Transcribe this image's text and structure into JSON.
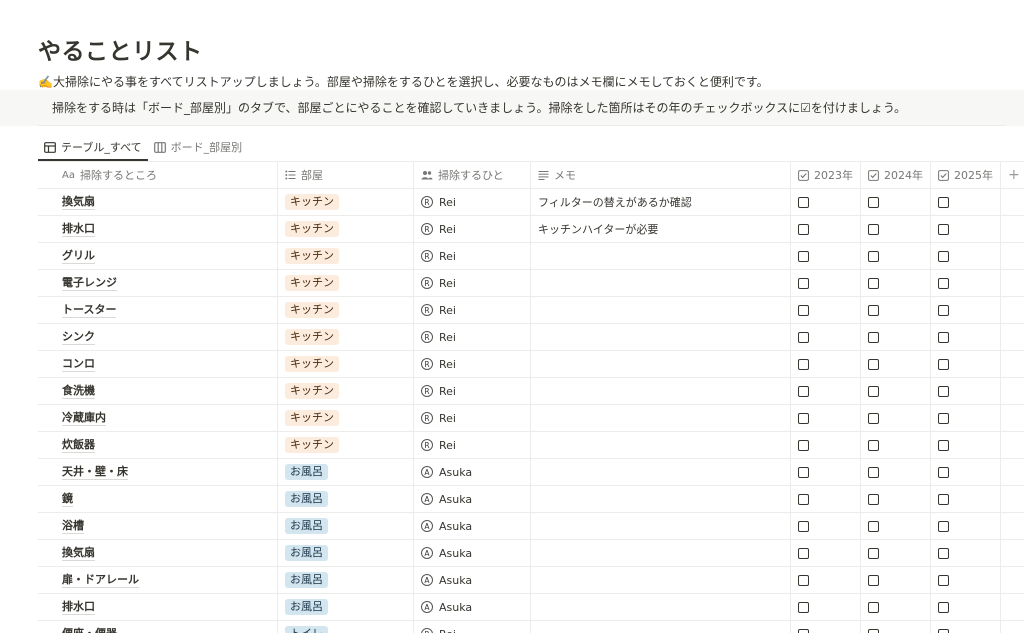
{
  "page": {
    "title": "やることリスト",
    "description_line1": "✍️大掃除にやる事をすべてリストアップしましょう。部屋や掃除をするひとを選択し、必要なものはメモ欄にメモしておくと便利です。",
    "description_line2": "掃除をする時は「ボード_部屋別」のタブで、部屋ごとにやることを確認していきましょう。掃除をした箇所はその年のチェックボックスに☑を付けましょう。"
  },
  "tabs": [
    {
      "label": "テーブル_すべて",
      "icon": "table-icon",
      "active": true
    },
    {
      "label": "ボード_部屋別",
      "icon": "board-icon",
      "active": false
    }
  ],
  "columns": {
    "name": {
      "label": "掃除するところ",
      "icon_text": "Aa"
    },
    "room": {
      "label": "部屋",
      "icon": "list-icon"
    },
    "who": {
      "label": "掃除するひと",
      "icon": "people-icon"
    },
    "memo": {
      "label": "メモ",
      "icon": "text-icon"
    },
    "y2023": {
      "label": "2023年",
      "icon": "checkbox-icon"
    },
    "y2024": {
      "label": "2024年",
      "icon": "checkbox-icon"
    },
    "y2025": {
      "label": "2025年",
      "icon": "checkbox-icon"
    },
    "add": {
      "label": "+"
    }
  },
  "room_colors": {
    "キッチン": {
      "bg": "#fbecdd",
      "fg": "#49290e"
    },
    "お風呂": {
      "bg": "#d3e5ef",
      "fg": "#183347"
    },
    "トイレ": {
      "bg": "#d3e5ef",
      "fg": "#183347"
    }
  },
  "rows": [
    {
      "name": "換気扇",
      "room": "キッチン",
      "avatar": "R",
      "who": "Rei",
      "memo": "フィルターの替えがあるか確認"
    },
    {
      "name": "排水口",
      "room": "キッチン",
      "avatar": "R",
      "who": "Rei",
      "memo": "キッチンハイターが必要"
    },
    {
      "name": "グリル",
      "room": "キッチン",
      "avatar": "R",
      "who": "Rei",
      "memo": ""
    },
    {
      "name": "電子レンジ",
      "room": "キッチン",
      "avatar": "R",
      "who": "Rei",
      "memo": ""
    },
    {
      "name": "トースター",
      "room": "キッチン",
      "avatar": "R",
      "who": "Rei",
      "memo": ""
    },
    {
      "name": "シンク",
      "room": "キッチン",
      "avatar": "R",
      "who": "Rei",
      "memo": ""
    },
    {
      "name": "コンロ",
      "room": "キッチン",
      "avatar": "R",
      "who": "Rei",
      "memo": ""
    },
    {
      "name": "食洗機",
      "room": "キッチン",
      "avatar": "R",
      "who": "Rei",
      "memo": ""
    },
    {
      "name": "冷蔵庫内",
      "room": "キッチン",
      "avatar": "R",
      "who": "Rei",
      "memo": ""
    },
    {
      "name": "炊飯器",
      "room": "キッチン",
      "avatar": "R",
      "who": "Rei",
      "memo": ""
    },
    {
      "name": "天井・壁・床",
      "room": "お風呂",
      "avatar": "A",
      "who": "Asuka",
      "memo": ""
    },
    {
      "name": "鏡",
      "room": "お風呂",
      "avatar": "A",
      "who": "Asuka",
      "memo": ""
    },
    {
      "name": "浴槽",
      "room": "お風呂",
      "avatar": "A",
      "who": "Asuka",
      "memo": ""
    },
    {
      "name": "換気扇",
      "room": "お風呂",
      "avatar": "A",
      "who": "Asuka",
      "memo": ""
    },
    {
      "name": "扉・ドアレール",
      "room": "お風呂",
      "avatar": "A",
      "who": "Asuka",
      "memo": ""
    },
    {
      "name": "排水口",
      "room": "お風呂",
      "avatar": "A",
      "who": "Asuka",
      "memo": ""
    },
    {
      "name": "便座・便器",
      "room": "トイレ",
      "avatar": "R",
      "who": "Rei",
      "memo": ""
    }
  ]
}
